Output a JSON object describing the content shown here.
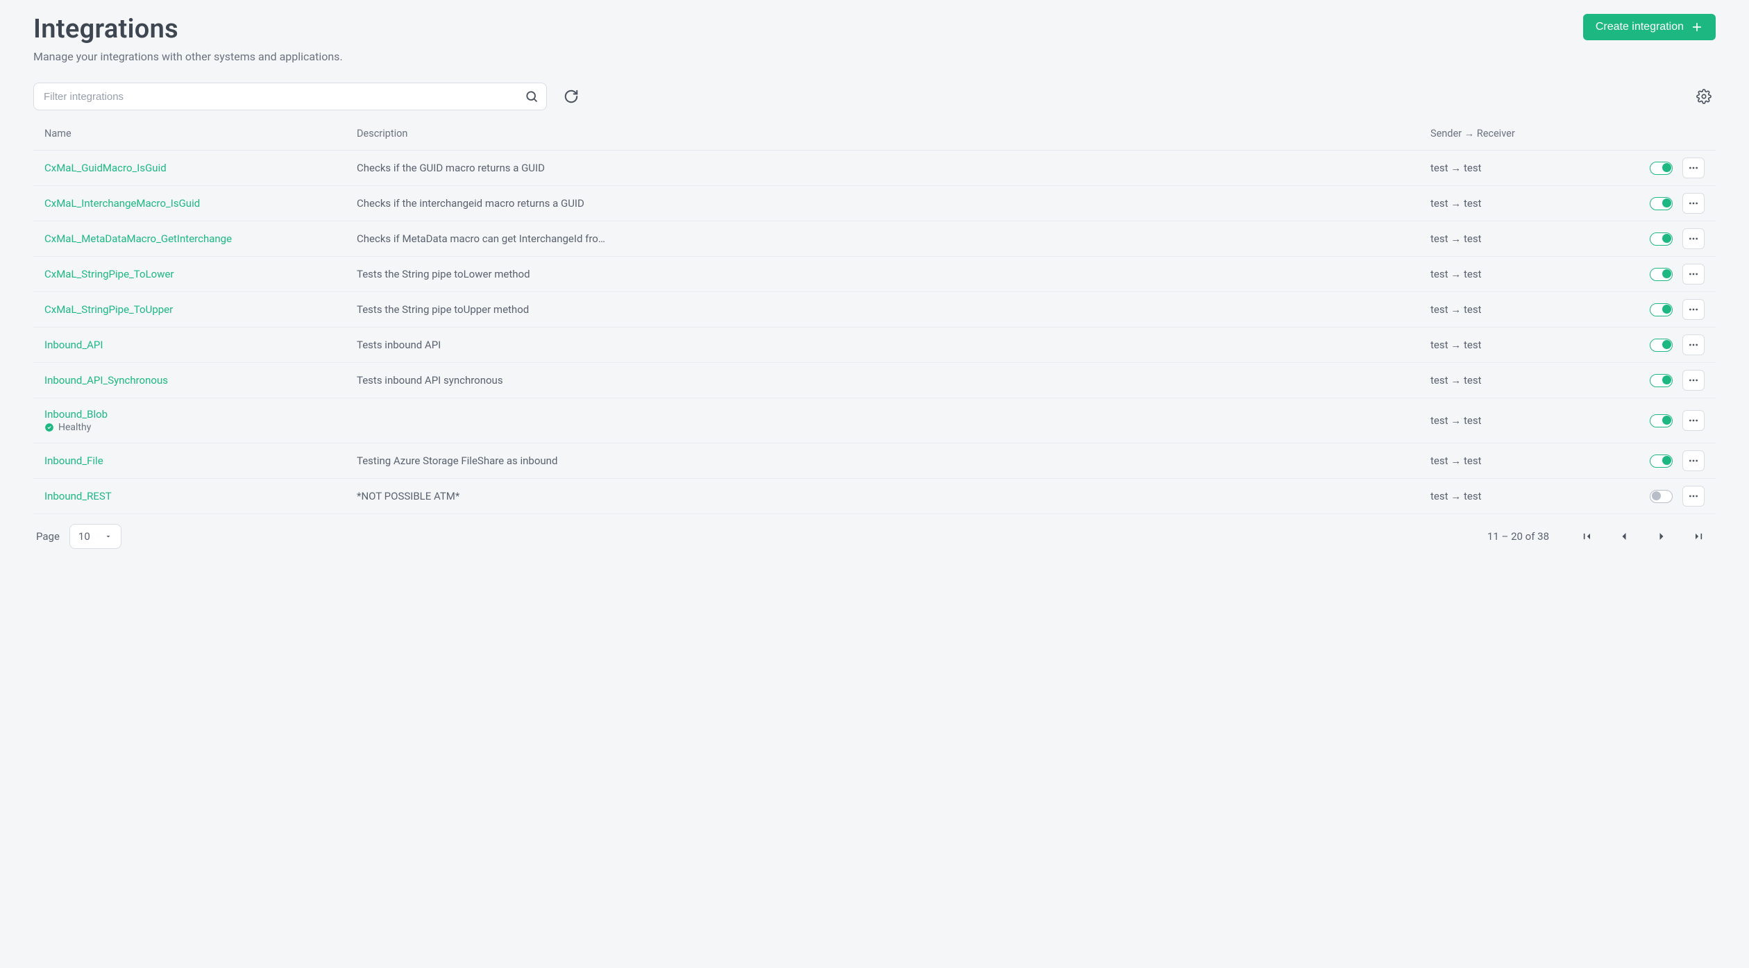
{
  "page": {
    "title": "Integrations",
    "subtitle": "Manage your integrations with other systems and applications.",
    "create_button": "Create integration"
  },
  "toolbar": {
    "filter_placeholder": "Filter integrations"
  },
  "columns": {
    "name": "Name",
    "description": "Description",
    "sender_receiver": "Sender → Receiver"
  },
  "rows": [
    {
      "name": "CxMaL_GuidMacro_IsGuid",
      "description": "Checks if the GUID macro returns a GUID",
      "sr": "test → test",
      "enabled": true
    },
    {
      "name": "CxMaL_InterchangeMacro_IsGuid",
      "description": "Checks if the interchangeid macro returns a GUID",
      "sr": "test → test",
      "enabled": true
    },
    {
      "name": "CxMaL_MetaDataMacro_GetInterchange",
      "description": "Checks if MetaData macro can get InterchangeId fro…",
      "sr": "test → test",
      "enabled": true
    },
    {
      "name": "CxMaL_StringPipe_ToLower",
      "description": "Tests the String pipe toLower method",
      "sr": "test → test",
      "enabled": true
    },
    {
      "name": "CxMaL_StringPipe_ToUpper",
      "description": "Tests the String pipe toUpper method",
      "sr": "test → test",
      "enabled": true
    },
    {
      "name": "Inbound_API",
      "description": "Tests inbound API",
      "sr": "test → test",
      "enabled": true
    },
    {
      "name": "Inbound_API_Synchronous",
      "description": "Tests inbound API synchronous",
      "sr": "test → test",
      "enabled": true
    },
    {
      "name": "Inbound_Blob",
      "description": "",
      "sr": "test → test",
      "enabled": true,
      "health": "Healthy"
    },
    {
      "name": "Inbound_File",
      "description": "Testing Azure Storage FileShare as inbound",
      "sr": "test → test",
      "enabled": true
    },
    {
      "name": "Inbound_REST",
      "description": "*NOT POSSIBLE ATM*",
      "sr": "test → test",
      "enabled": false
    }
  ],
  "pagination": {
    "page_label": "Page",
    "page_size": "10",
    "range_text": "11 – 20 of 38"
  }
}
